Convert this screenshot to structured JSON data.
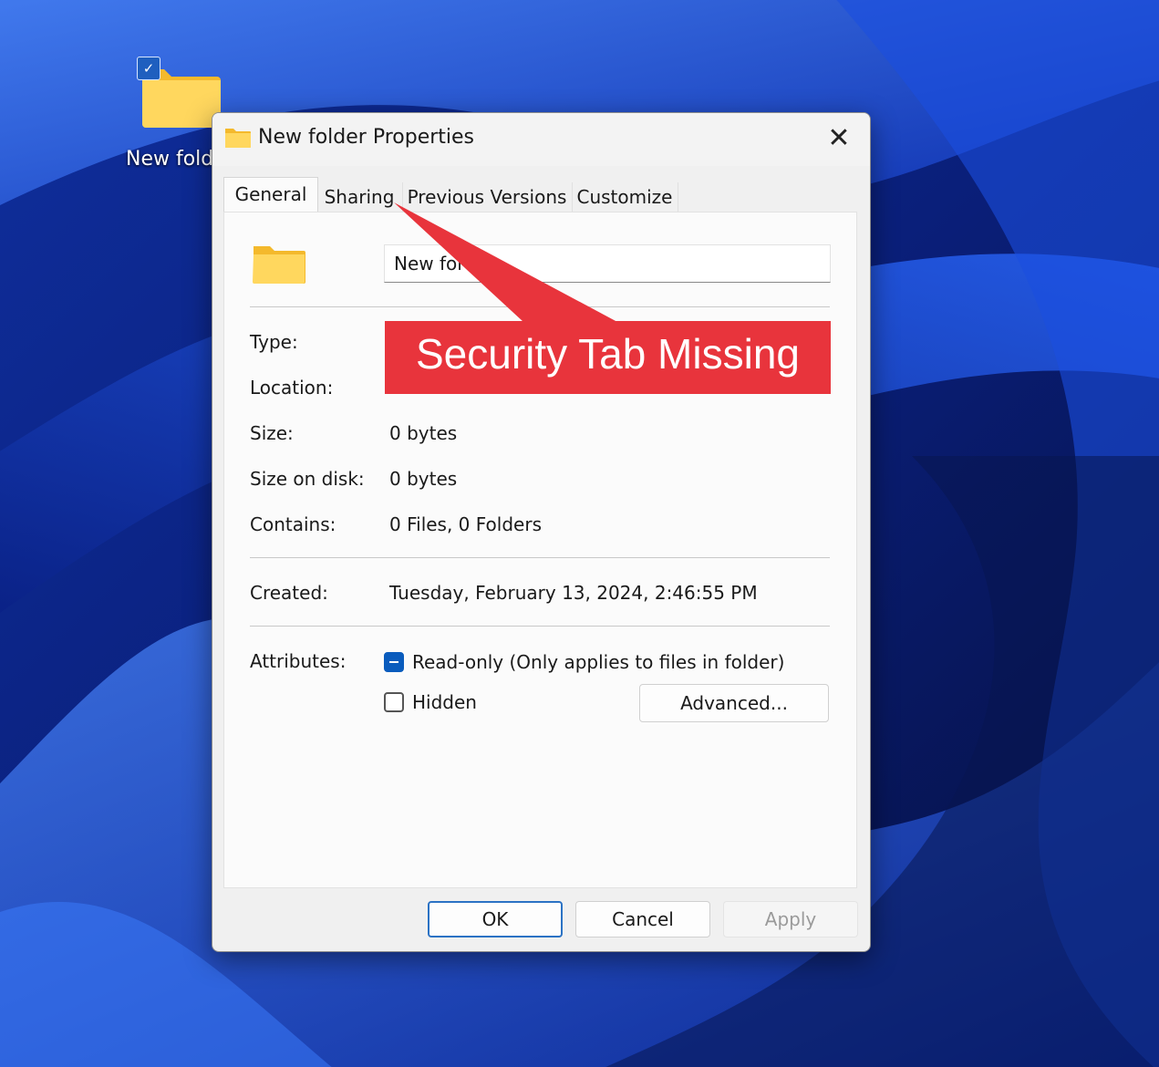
{
  "desktop": {
    "folder_label": "New fold",
    "selected": true
  },
  "dialog": {
    "title": "New folder Properties",
    "close_glyph": "✕",
    "tabs": [
      {
        "label": "General",
        "active": true
      },
      {
        "label": "Sharing",
        "active": false
      },
      {
        "label": "Previous Versions",
        "active": false
      },
      {
        "label": "Customize",
        "active": false
      }
    ],
    "general": {
      "name_value": "New fol",
      "rows": [
        {
          "label": "Type:",
          "value": ""
        },
        {
          "label": "Location:",
          "value": ""
        },
        {
          "label": "Size:",
          "value": "0 bytes"
        },
        {
          "label": "Size on disk:",
          "value": "0 bytes"
        },
        {
          "label": "Contains:",
          "value": "0 Files, 0 Folders"
        }
      ],
      "created_label": "Created:",
      "created_value": "Tuesday, February 13, 2024, 2:46:55 PM",
      "attributes_label": "Attributes:",
      "readonly_label": "Read-only (Only applies to files in folder)",
      "readonly_state": "indeterminate",
      "hidden_label": "Hidden",
      "hidden_state": "unchecked",
      "advanced_label": "Advanced..."
    },
    "buttons": {
      "ok": "OK",
      "cancel": "Cancel",
      "apply": "Apply"
    }
  },
  "annotation": {
    "text": "Security Tab Missing",
    "color": "#e8343c"
  },
  "colors": {
    "folder_yellow": "#ffd75e",
    "accent_blue": "#0a5cbd"
  },
  "icons": [
    "folder-icon",
    "close-icon",
    "checkmark-icon"
  ]
}
